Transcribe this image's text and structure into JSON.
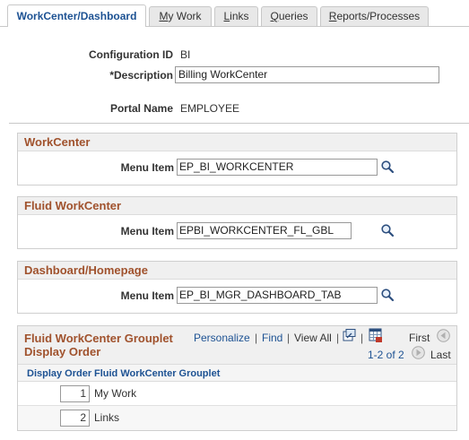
{
  "tabs": [
    {
      "label": "WorkCenter/Dashboard",
      "active": true
    },
    {
      "label_pre": "",
      "label_u": "M",
      "label_post": "y Work"
    },
    {
      "label_pre": "",
      "label_u": "L",
      "label_post": "inks"
    },
    {
      "label_pre": "",
      "label_u": "Q",
      "label_post": "ueries"
    },
    {
      "label_pre": "",
      "label_u": "R",
      "label_post": "eports/Processes"
    }
  ],
  "header": {
    "config_id_label": "Configuration ID",
    "config_id_value": "BI",
    "description_label": "*Description",
    "description_value": "Billing WorkCenter",
    "portal_label": "Portal Name",
    "portal_value": "EMPLOYEE"
  },
  "sections": [
    {
      "title": "WorkCenter",
      "field_label": "Menu Item",
      "field_value": "EP_BI_WORKCENTER"
    },
    {
      "title": "Fluid WorkCenter",
      "field_label": "Menu Item",
      "field_value": "EPBI_WORKCENTER_FL_GBL"
    },
    {
      "title": "Dashboard/Homepage",
      "field_label": "Menu Item",
      "field_value": "EP_BI_MGR_DASHBOARD_TAB"
    }
  ],
  "grid": {
    "title": "Fluid WorkCenter Grouplet Display Order",
    "personalize": "Personalize",
    "find": "Find",
    "view_all": "View All",
    "sep": "|",
    "first": "First",
    "range": "1-2 of 2",
    "last": "Last",
    "columns": [
      "Display Order",
      "Fluid WorkCenter Grouplet"
    ],
    "rows": [
      {
        "order": "1",
        "name": "My Work"
      },
      {
        "order": "2",
        "name": "Links"
      }
    ]
  },
  "colors": {
    "accent": "#1d5293",
    "section_title": "#a0522d",
    "border": "#cfcfcf"
  },
  "icons": [
    "magnifier-lookup-icon",
    "new-window-icon",
    "grid-download-icon",
    "previous-arrow-icon",
    "next-arrow-icon"
  ]
}
